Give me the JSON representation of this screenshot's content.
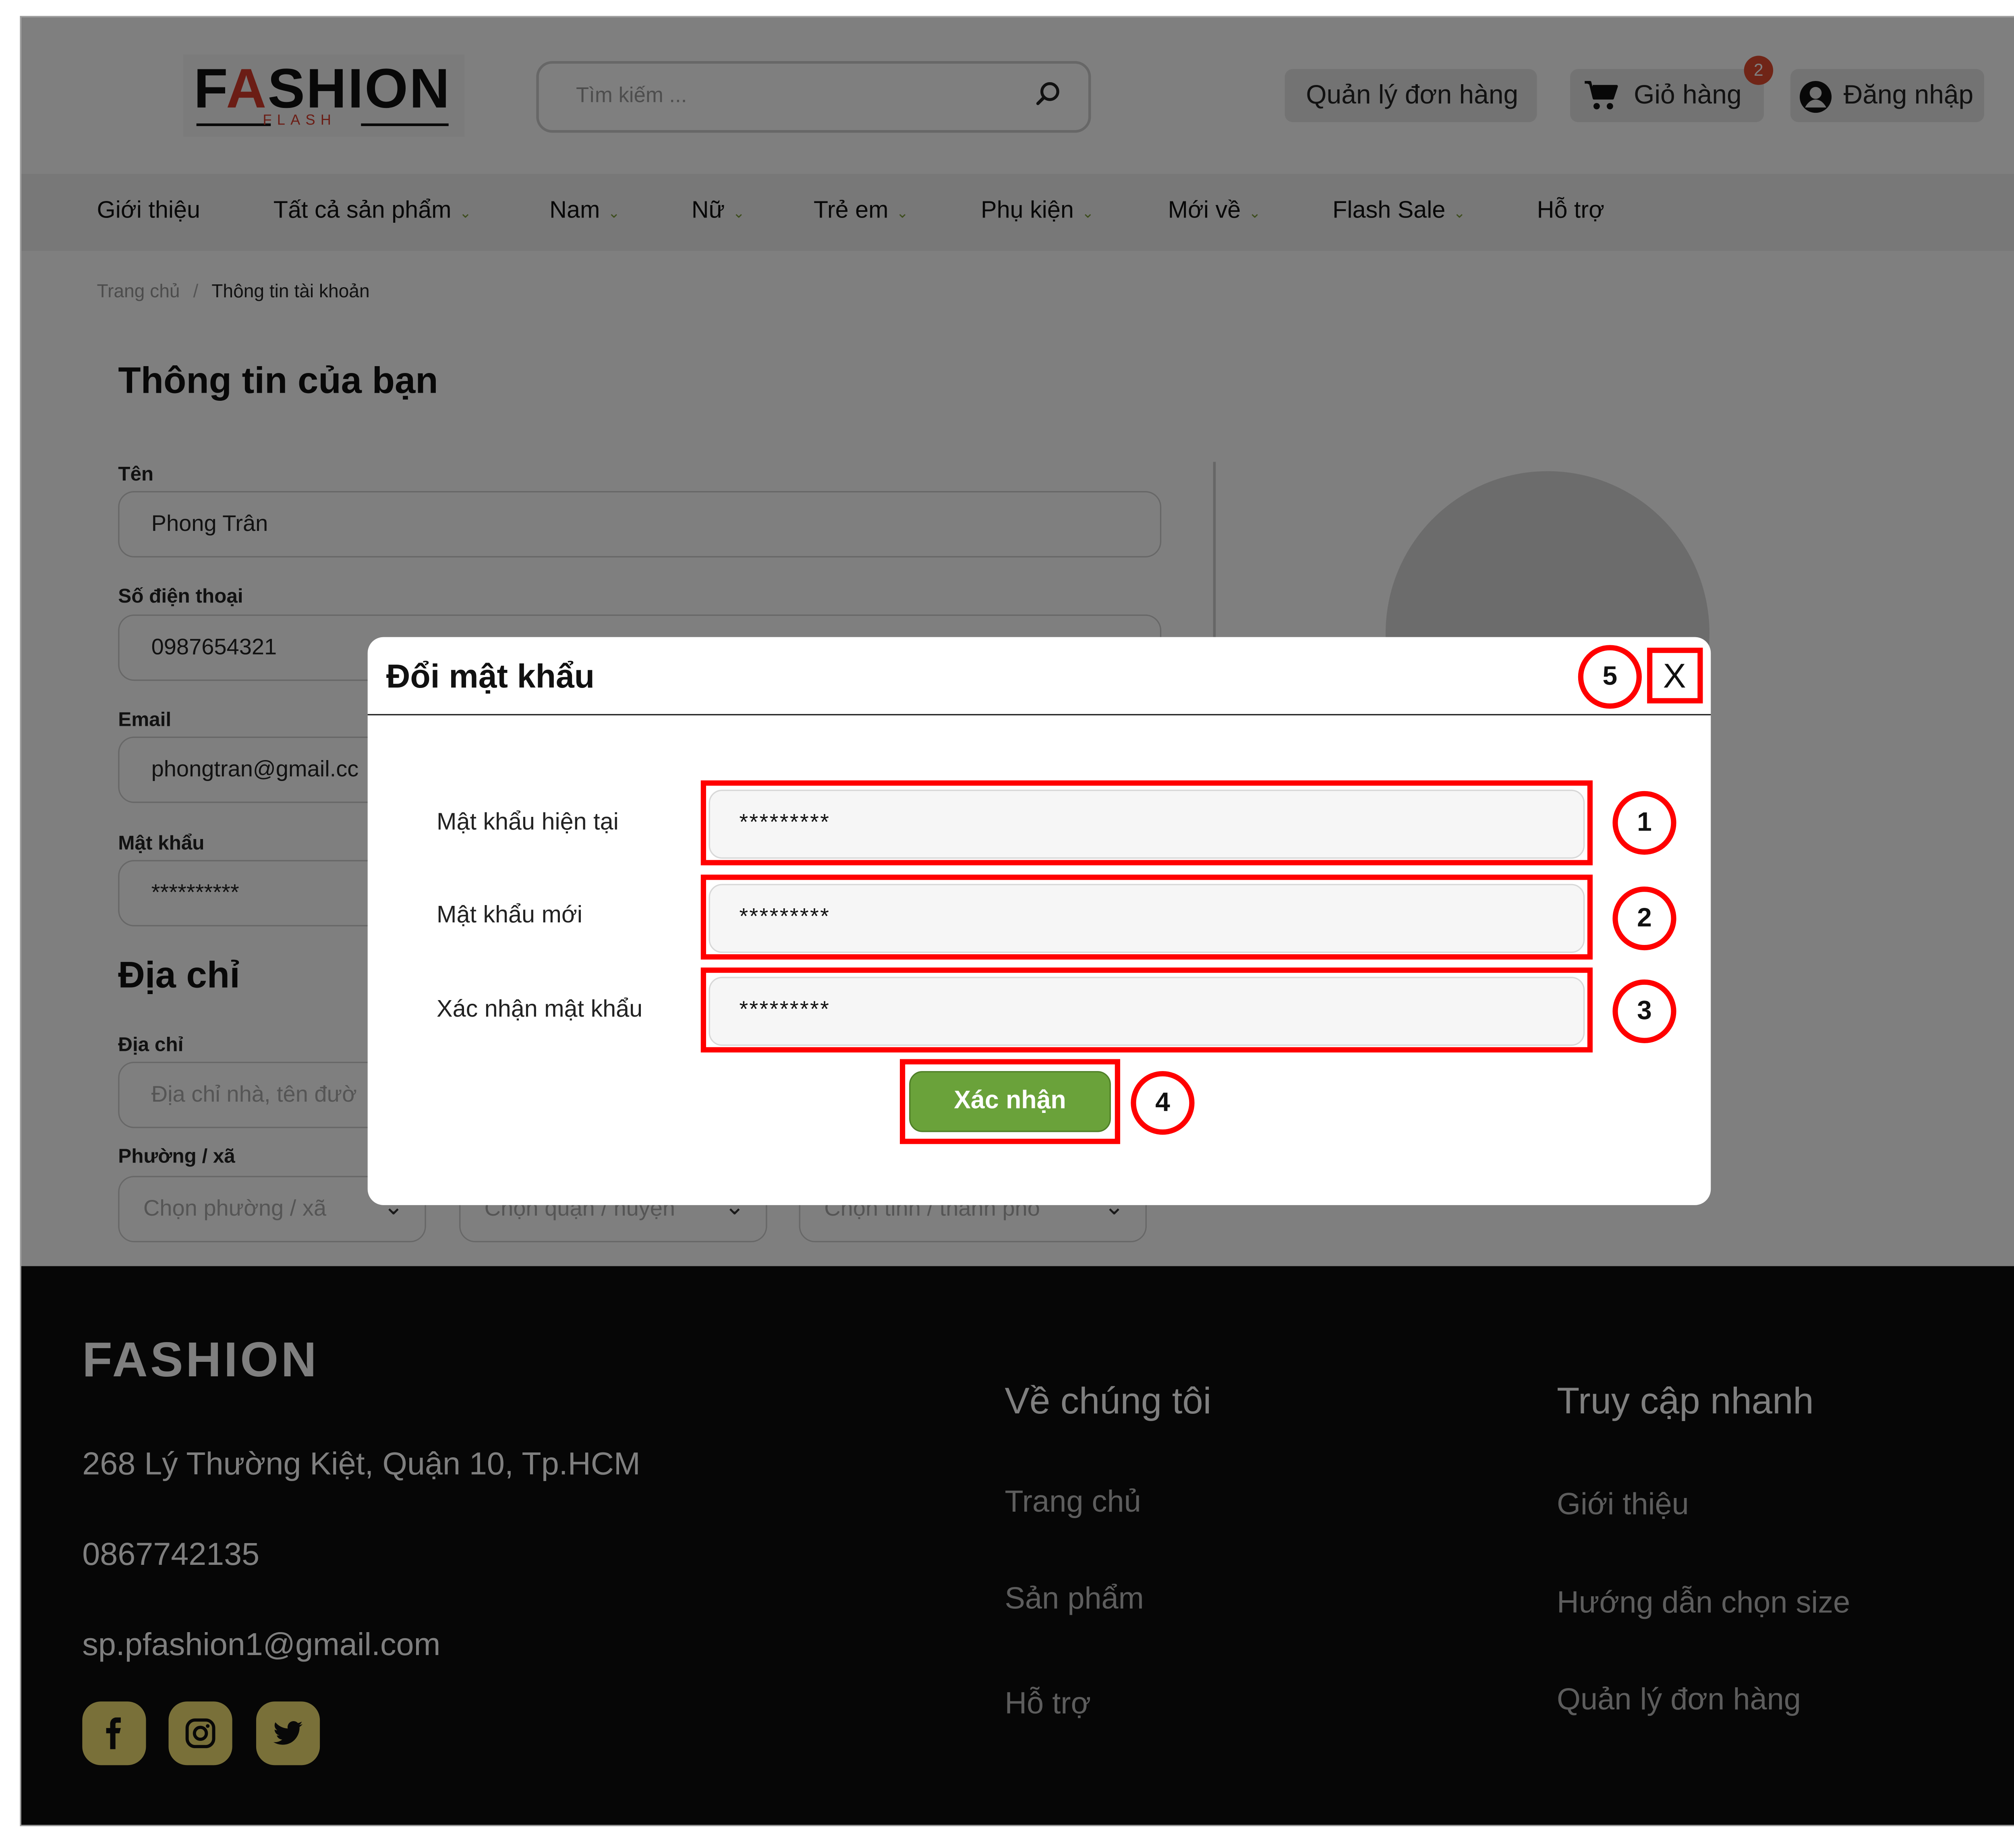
{
  "header": {
    "logo_text": "FASHION",
    "logo_sub": "FLASH",
    "search_placeholder": "Tìm kiếm ...",
    "orders_button": "Quản lý đơn hàng",
    "cart_button": "Giỏ hàng",
    "cart_count": "2",
    "login_button": "Đăng nhập"
  },
  "nav": {
    "items": [
      {
        "label": "Giới thiệu"
      },
      {
        "label": "Tất cả sản phẩm"
      },
      {
        "label": "Nam"
      },
      {
        "label": "Nữ"
      },
      {
        "label": "Trẻ em"
      },
      {
        "label": "Phụ kiện"
      },
      {
        "label": "Mới về"
      },
      {
        "label": "Flash Sale"
      },
      {
        "label": "Hỗ trợ"
      }
    ]
  },
  "breadcrumb": {
    "home": "Trang chủ",
    "separator": "/",
    "current": "Thông tin tài khoản"
  },
  "profile": {
    "title": "Thông tin của bạn",
    "name_label": "Tên",
    "name_value": "Phong Trân",
    "phone_label": "Số điện thoại",
    "phone_value": "0987654321",
    "email_label": "Email",
    "email_value": "phongtran@gmail.cc",
    "password_label": "Mật khẩu",
    "password_value": "**********",
    "address_title": "Địa chỉ",
    "address_label": "Địa chỉ",
    "address_placeholder": "Địa chỉ nhà, tên đườ",
    "ward_label": "Phường / xã",
    "ward_placeholder": "Chọn phường / xã",
    "district_placeholder": "Chọn quận / huyện",
    "province_placeholder": "Chọn tỉnh / thành phố"
  },
  "modal": {
    "title": "Đổi mật khẩu",
    "close_label": "X",
    "current_password_label": "Mật khẩu hiện tại",
    "current_password_value": "*********",
    "new_password_label": "Mật khẩu mới",
    "new_password_value": "*********",
    "confirm_password_label": "Xác nhận mật khẩu",
    "confirm_password_value": "*********",
    "submit_label": "Xác nhận"
  },
  "annotations": [
    "1",
    "2",
    "3",
    "4",
    "5"
  ],
  "footer": {
    "brand": "FASHION",
    "address": "268 Lý Thường Kiệt, Quận 10, Tp.HCM",
    "phone": "0867742135",
    "email": "sp.pfashion1@gmail.com",
    "about_heading": "Về chúng tôi",
    "about_links": [
      "Trang chủ",
      "Sản phẩm",
      "Hỗ trợ"
    ],
    "quick_heading": "Truy cập nhanh",
    "quick_links": [
      "Giới thiệu",
      "Hướng dẫn chọn size",
      "Quản lý đơn hàng"
    ]
  },
  "colors": {
    "accent_green": "#6aa23a",
    "annotation_red": "#ff0000",
    "badge_orange": "#e04b2f",
    "social_yellow": "#f3e173",
    "footer_bg": "#0c0c0c"
  }
}
